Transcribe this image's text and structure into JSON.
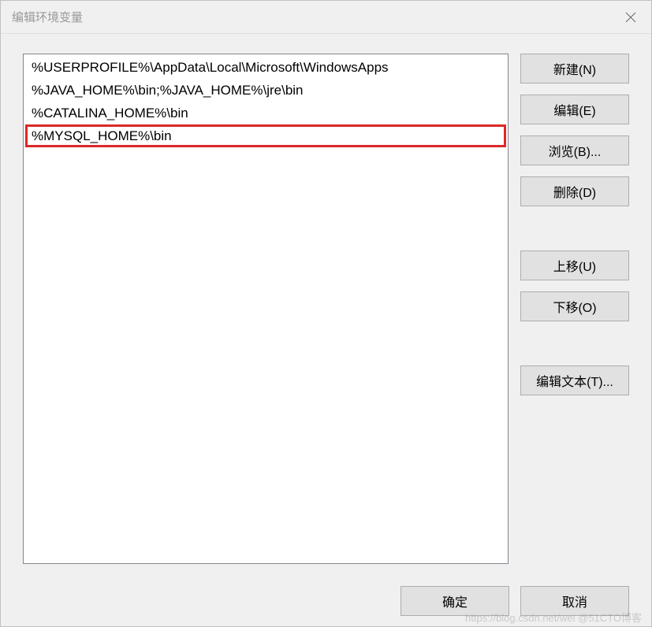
{
  "dialog": {
    "title": "编辑环境变量"
  },
  "list": {
    "items": [
      "%USERPROFILE%\\AppData\\Local\\Microsoft\\WindowsApps",
      "%JAVA_HOME%\\bin;%JAVA_HOME%\\jre\\bin",
      "%CATALINA_HOME%\\bin",
      "%MYSQL_HOME%\\bin"
    ],
    "highlighted_index": 3
  },
  "buttons": {
    "new": "新建(N)",
    "edit": "编辑(E)",
    "browse": "浏览(B)...",
    "delete": "删除(D)",
    "move_up": "上移(U)",
    "move_down": "下移(O)",
    "edit_text": "编辑文本(T)...",
    "ok": "确定",
    "cancel": "取消"
  },
  "watermark": "https://blog.csdn.net/wei @51CTO博客"
}
